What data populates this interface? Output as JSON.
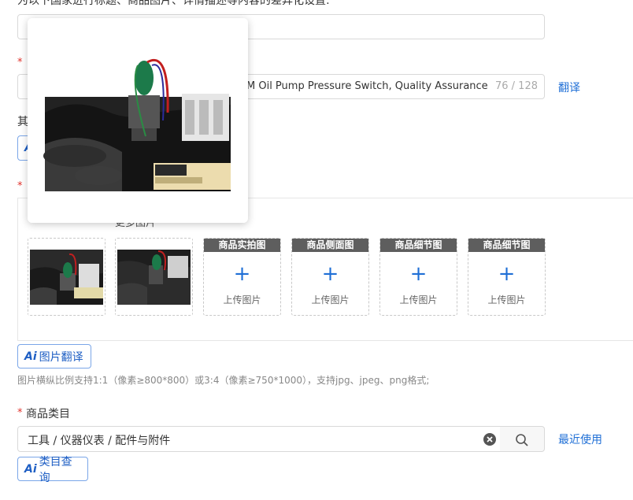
{
  "intro_text": "为以下国家进行标题、商品图片、详情描述等内容的差异化设置:",
  "title_field": {
    "value_visible": "M Oil Pump Pressure Switch, Quality Assurance",
    "counter": "76 / 128",
    "translate_link": "翻译"
  },
  "other_label_partial": "其",
  "required_mark": "*",
  "images": {
    "partial_label": "更多图片",
    "slots": [
      {
        "header": "商品实拍图",
        "upload": "上传图片"
      },
      {
        "header": "商品侧面图",
        "upload": "上传图片"
      },
      {
        "header": "商品细节图",
        "upload": "上传图片"
      },
      {
        "header": "商品细节图",
        "upload": "上传图片"
      }
    ],
    "ai_translate_label": "图片翻译",
    "hint": "图片横纵比例支持1:1（像素≥800*800）或3:4（像素≥750*1000），支持jpg、jpeg、png格式;"
  },
  "category": {
    "label": "商品类目",
    "value": "工具 / 仪器仪表 / 配件与附件",
    "recent_link": "最近使用",
    "ai_query_label": "类目查询"
  },
  "ai_badge": "Ai",
  "icons": {
    "clear": "clear-circle-icon",
    "search": "search-icon",
    "plus": "+"
  }
}
